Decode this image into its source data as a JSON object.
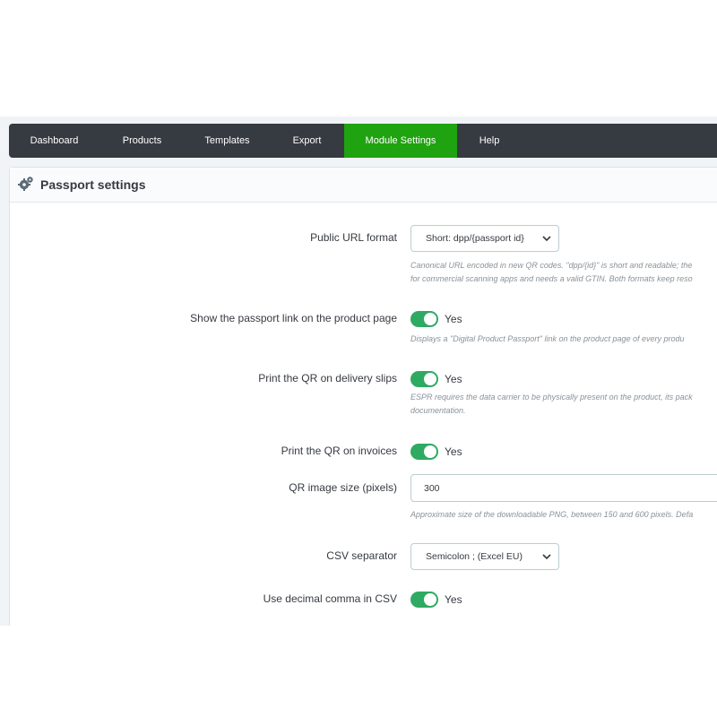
{
  "nav": {
    "tabs": [
      {
        "label": "Dashboard",
        "active": false
      },
      {
        "label": "Products",
        "active": false
      },
      {
        "label": "Templates",
        "active": false
      },
      {
        "label": "Export",
        "active": false
      },
      {
        "label": "Module Settings",
        "active": true
      },
      {
        "label": "Help",
        "active": false
      }
    ]
  },
  "panel": {
    "icon": "gears-icon",
    "title": "Passport settings"
  },
  "fields": {
    "public_url": {
      "label": "Public URL format",
      "value": "Short: dpp/{passport id}",
      "help_line1": "Canonical URL encoded in new QR codes. \"dpp/{id}\" is short and readable; the",
      "help_line2": "for commercial scanning apps and needs a valid GTIN. Both formats keep reso"
    },
    "show_link": {
      "label": "Show the passport link on the product page",
      "value": "Yes",
      "help": "Displays a \"Digital Product Passport\" link on the product page of every produ"
    },
    "qr_delivery": {
      "label": "Print the QR on delivery slips",
      "value": "Yes",
      "help_line1": "ESPR requires the data carrier to be physically present on the product, its pack",
      "help_line2": "documentation."
    },
    "qr_invoices": {
      "label": "Print the QR on invoices",
      "value": "Yes"
    },
    "qr_size": {
      "label": "QR image size (pixels)",
      "value": "300",
      "help": "Approximate size of the downloadable PNG, between 150 and 600 pixels. Defa"
    },
    "csv_separator": {
      "label": "CSV separator",
      "value": "Semicolon ; (Excel EU)"
    },
    "decimal_comma": {
      "label": "Use decimal comma in CSV",
      "value": "Yes"
    }
  },
  "colors": {
    "nav_bg": "#363a41",
    "active_tab": "#1fa310",
    "switch_on": "#2eaa62"
  }
}
